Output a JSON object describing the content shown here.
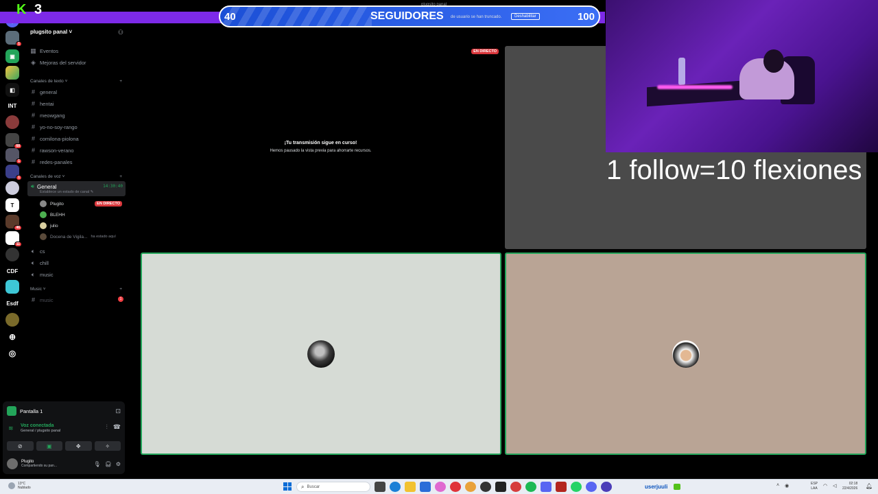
{
  "overlay": {
    "kick_letter": "K",
    "kick_count": "3",
    "goal_start": "40",
    "goal_title": "SEGUIDORES",
    "goal_end": "100",
    "goal_progress": 0.4,
    "caption": "1 follow=10 flexiones",
    "top_label": "plugsito panal",
    "notice": "de usuario se han truncado.",
    "notice_button": "Deshabilitar"
  },
  "rail": {
    "items": [
      {
        "label": "INT"
      },
      {
        "label": "CDF"
      },
      {
        "label": "Esdf"
      }
    ]
  },
  "sidebar": {
    "server_name": "plugsito panal ˅",
    "events": "Eventos",
    "boosts": "Mejoras del servidor",
    "text_category": "Canales de texto ˅",
    "text_channels": [
      "general",
      "hentai",
      "meowgang",
      "yo-no-soy-rango",
      "comilona-piolona",
      "rawson-verano",
      "redes-panales"
    ],
    "voice_category": "Canales de voz ˅",
    "active_voice": {
      "name": "General",
      "time": "14:30:40",
      "status": "Establece un estado de canal ✎"
    },
    "members": [
      {
        "name": "Plugito",
        "live": "EN DIRECTO"
      },
      {
        "name": "BLEHH"
      },
      {
        "name": "julio"
      },
      {
        "name": "Docena de Vigila...",
        "extra": "ha estado aquí"
      }
    ],
    "voice_channels": [
      "cs",
      "chill",
      "music"
    ],
    "music_category": "Music ˅",
    "music_channel": "music",
    "music_badge": "1"
  },
  "panel": {
    "screen": "Pantalla 1",
    "voice_status": "Voz conectada",
    "voice_location": "General / plugsito panal",
    "user_name": "Plugito",
    "user_status": "Compartiendo su pan..."
  },
  "stage": {
    "live_label": "EN DIRECTO",
    "paused_title": "¡Tu transmisión sigue en curso!",
    "paused_sub": "Hemos pausado la vista previa para ahorrarte recursos."
  },
  "taskbar": {
    "temp": "13°C",
    "weather": "Nublado",
    "search_placeholder": "Buscar",
    "user": "userjuuli",
    "lang1": "ESP",
    "lang2": "LAA",
    "time": "02:18",
    "date": "22/4/2026"
  },
  "colors": {
    "discord_green": "#23a55a",
    "live_red": "#da373c",
    "overlay_purple": "#7d2ae8",
    "goal_blue": "#1b4fd6",
    "kick_green": "#53fc18"
  }
}
